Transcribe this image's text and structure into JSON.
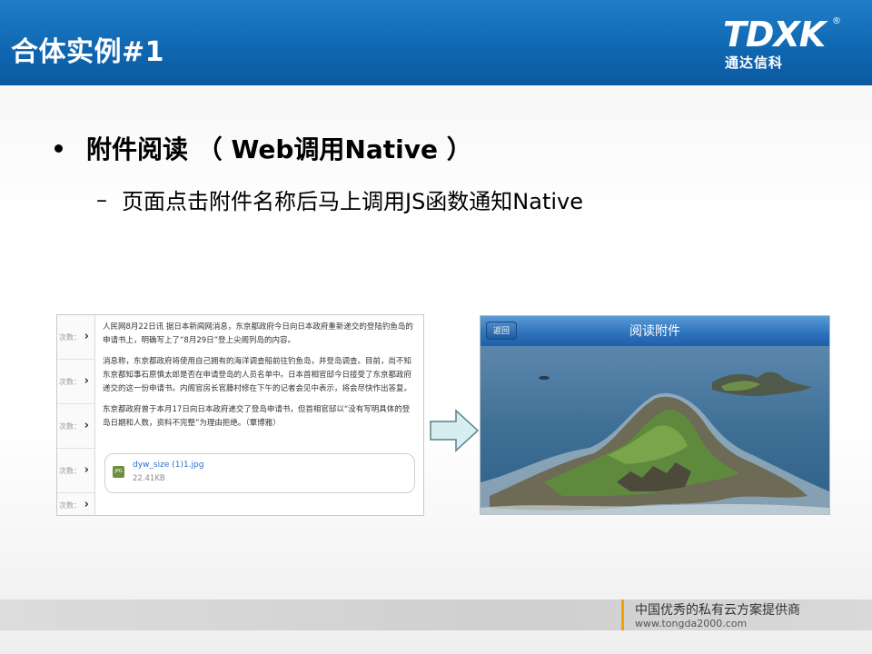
{
  "header": {
    "title": "合体实例#1",
    "logo_text": "TDXK",
    "logo_registered": "®",
    "logo_subtitle": "通达信科"
  },
  "bullet": {
    "main": "附件阅读 （ Web调用Native ）",
    "sub": "页面点击附件名称后马上调用JS函数通知Native"
  },
  "left_screenshot": {
    "side_items": [
      {
        "label": "次数："
      },
      {
        "label": "次数："
      },
      {
        "label": "次数："
      },
      {
        "label": "次数："
      }
    ],
    "side_last": "次数：",
    "paragraphs": [
      "人民网8月22日讯 据日本新闻网消息，东京都政府今日向日本政府重新递交的登陆钓鱼岛的申请书上，明确写上了“8月29日”登上尖阁列岛的内容。",
      "消息称，东京都政府将使用自己拥有的海洋调查船前往钓鱼岛，并登岛调查。目前，尚不知东京都知事石原慎太郎是否在申请登岛的人员名单中。日本首相官邸今日接受了东京都政府递交的这一份申请书。内阁官房长官藤村修在下午的记者会见中表示，将会尽快作出答复。",
      "东京都政府曾于本月17日向日本政府递交了登岛申请书，但首相官邸以“没有写明具体的登岛日期和人数，资料不完整”为理由拒绝。（覃博雅）"
    ],
    "attachment": {
      "icon": "jpg-file-icon",
      "icon_text": "JPG",
      "name": "dyw_size (1)1.jpg",
      "size": "22.41KB"
    }
  },
  "right_screenshot": {
    "back_label": "返回",
    "title": "阅读附件"
  },
  "footer": {
    "slogan": "中国优秀的私有云方案提供商",
    "url": "www.tongda2000.com"
  },
  "colors": {
    "header_blue": "#0f66b0",
    "accent_orange": "#f2a300",
    "link_blue": "#2a6fc9"
  }
}
